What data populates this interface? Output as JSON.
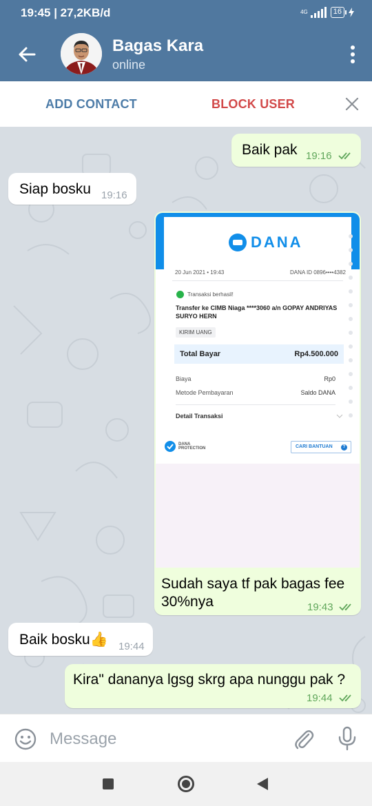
{
  "status_bar": {
    "time_speed": "19:45 | 27,2KB/d",
    "network": "4G",
    "battery": "16"
  },
  "header": {
    "contact_name": "Bagas Kara",
    "contact_status": "online"
  },
  "actions": {
    "add_contact": "ADD CONTACT",
    "block_user": "BLOCK USER"
  },
  "messages": [
    {
      "direction": "out",
      "text": "Baik pak",
      "time": "19:16",
      "read": true
    },
    {
      "direction": "in",
      "text": "Siap bosku",
      "time": "19:16"
    },
    {
      "direction": "out",
      "type": "image",
      "caption": "Sudah saya tf pak bagas fee 30%nya",
      "time": "19:43",
      "read": true
    },
    {
      "direction": "in",
      "text": "Baik bosku👍",
      "time": "19:44"
    },
    {
      "direction": "out",
      "text": "Kira\" dananya lgsg skrg apa nunggu pak ?",
      "time": "19:44",
      "read": true
    }
  ],
  "receipt": {
    "brand": "DANA",
    "date": "20 Jun 2021 • 19:43",
    "dana_id": "DANA ID 0896••••4382",
    "status": "Transaksi berhasil!",
    "description": "Transfer ke CIMB Niaga ****3060 a/n GOPAY ANDRIYAS SURYO HERN",
    "type_tag": "KIRIM UANG",
    "total_label": "Total Bayar",
    "total_value": "Rp4.500.000",
    "fee_label": "Biaya",
    "fee_value": "Rp0",
    "method_label": "Metode Pembayaran",
    "method_value": "Saldo DANA",
    "detail_label": "Detail Transaksi",
    "protection_line1": "DANA",
    "protection_line2": "PROTECTION",
    "help_button": "CARI BANTUAN"
  },
  "composer": {
    "placeholder": "Message"
  },
  "colors": {
    "header": "#50789f",
    "outgoing_bubble": "#effedd",
    "incoming_bubble": "#ffffff",
    "chat_background": "#d7dde3",
    "dana_blue": "#108ee9",
    "block_red": "#d24949"
  }
}
